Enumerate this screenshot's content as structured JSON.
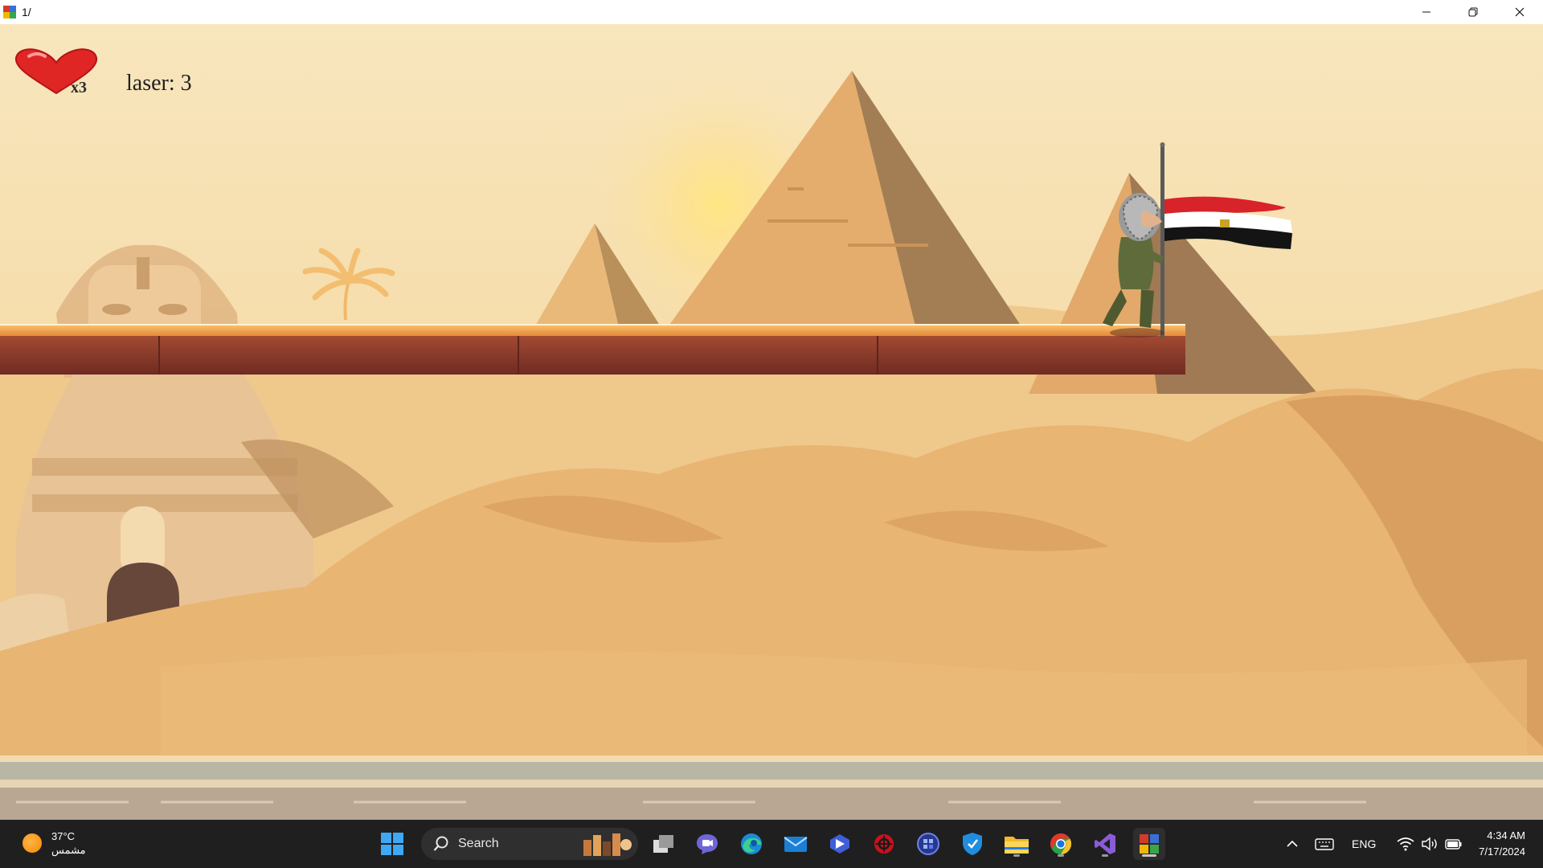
{
  "window": {
    "title": "1/",
    "minimize_icon": "minimize-icon",
    "restore_icon": "restore-icon",
    "close_icon": "close-icon"
  },
  "hud": {
    "lives": "x3",
    "laser_label": "laser: 3",
    "heart_icon": "heart-icon"
  },
  "flag": {
    "emblem_color": "#c9a227"
  },
  "colors": {
    "sky": "#f7e0ae",
    "platform_top": "#f0a248",
    "platform_body": "#8a3a2a",
    "taskbar": "#1f1f1f"
  },
  "taskbar": {
    "weather": {
      "temp": "37°C",
      "condition": "مشمس",
      "icon": "sun-icon"
    },
    "search_label": "Search",
    "apps": [
      "start-icon",
      "search-icon",
      "task-view-icon",
      "teams-icon",
      "edge-icon",
      "mail-icon",
      "copilot-icon",
      "security-icon",
      "widgets-icon",
      "defender-icon",
      "file-explorer-icon",
      "chrome-icon",
      "visual-studio-icon",
      "game-app-icon"
    ],
    "tray": {
      "language": "ENG",
      "time": "4:34 AM",
      "date": "7/17/2024"
    }
  }
}
